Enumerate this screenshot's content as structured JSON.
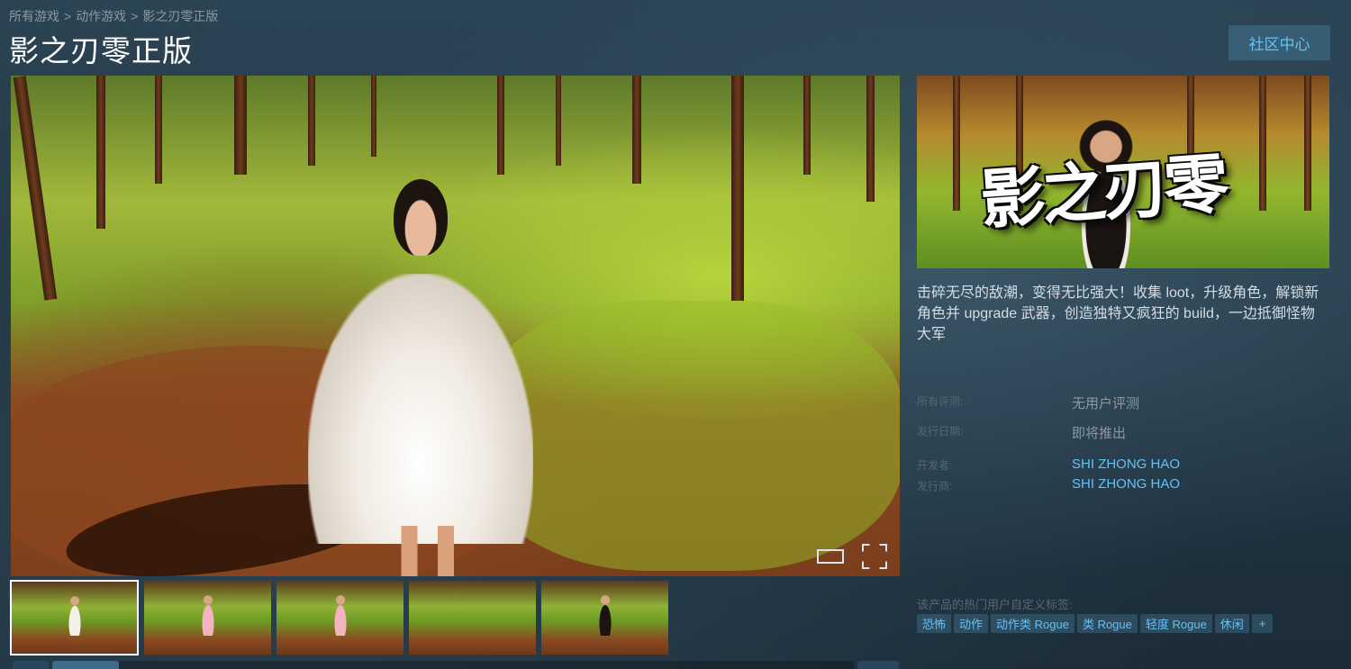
{
  "breadcrumb": {
    "items": [
      "所有游戏",
      "动作游戏",
      "影之刃零正版"
    ],
    "separator": ">"
  },
  "title": "影之刃零正版",
  "community_button": "社区中心",
  "main_screenshot": {
    "icons": [
      "widescreen-icon",
      "fullscreen-icon"
    ]
  },
  "thumbnails": [
    {
      "figure": "white-dress"
    },
    {
      "figure": "pink-dress"
    },
    {
      "figure": "pink-dress"
    },
    {
      "figure": "none"
    },
    {
      "figure": "black-dress"
    }
  ],
  "capsule": {
    "logo_text": "影之刃零"
  },
  "description": "击碎无尽的敌潮，变得无比强大！收集 loot，升级角色，解锁新角色并 upgrade 武器，创造独特又疯狂的 build，一边抵御怪物大军",
  "info": {
    "reviews_label": "所有评测:",
    "reviews_value": "无用户评测",
    "release_label": "发行日期:",
    "release_value": "即将推出",
    "developer_label": "开发者:",
    "developer_value": "SHI ZHONG HAO",
    "publisher_label": "发行商:",
    "publisher_value": "SHI ZHONG HAO"
  },
  "tags": {
    "title": "该产品的热门用户自定义标签:",
    "items": [
      "恐怖",
      "动作",
      "动作类 Rogue",
      "类 Rogue",
      "轻度 Rogue",
      "休闲"
    ],
    "more": "+"
  },
  "colors": {
    "link": "#66c0f4",
    "button_bg": "rgba(103,193,245,0.2)",
    "background": "#233846"
  }
}
